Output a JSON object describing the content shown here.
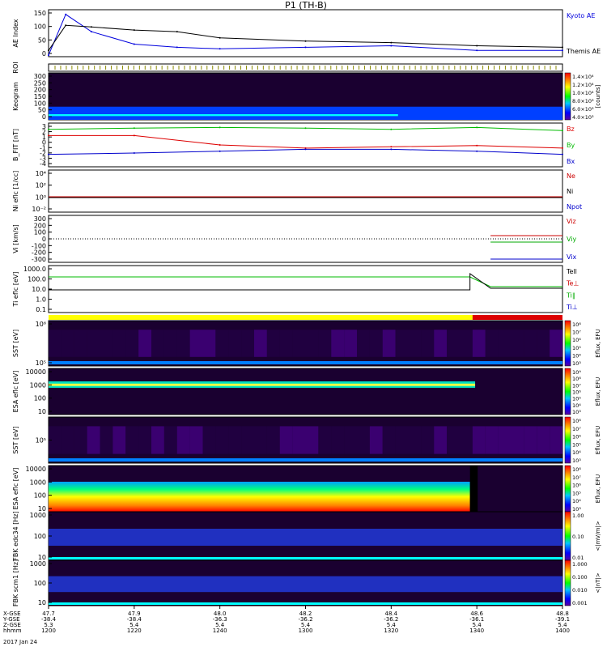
{
  "title": "P1 (TH-B)",
  "colors": {
    "kyoto": "#0000dd",
    "themis": "#000000",
    "bz": "#dd0000",
    "by": "#00bb00",
    "bx": "#0000cc",
    "flag_yellow": "#ffff00",
    "flag_red": "#dd0000"
  },
  "panels": [
    {
      "id": "ae",
      "ylabel": "AE Index",
      "ticks": [
        "150",
        "100",
        "50",
        "0"
      ],
      "legend": [
        "Kyoto AE",
        "Themis AE"
      ]
    },
    {
      "id": "roi",
      "ylabel": "ROI",
      "ticks": [],
      "legend": []
    },
    {
      "id": "keogram",
      "ylabel": "Keogram",
      "ticks": [
        "300",
        "250",
        "200",
        "150",
        "100",
        "50",
        "0"
      ],
      "legend": []
    },
    {
      "id": "bfield",
      "ylabel": "B_FIT [nT]",
      "ticks": [
        "3",
        "2",
        "1",
        "0",
        "-1",
        "-2",
        "-3",
        "-4"
      ],
      "legend": [
        "Bz",
        "By",
        "Bx"
      ]
    },
    {
      "id": "density",
      "ylabel": "Ni eflc [1/cc]",
      "ticks": [
        "10⁴",
        "10²",
        "10⁰",
        "10⁻²"
      ],
      "legend": [
        "Ne",
        "Ni",
        "Npot"
      ]
    },
    {
      "id": "velocity",
      "ylabel": "Vi [km/s]",
      "ticks": [
        "300",
        "200",
        "100",
        "0",
        "-100",
        "-200",
        "-300"
      ],
      "legend": [
        "Viz",
        "Viy",
        "Vix"
      ]
    },
    {
      "id": "temp",
      "ylabel": "Ti eflc [eV]",
      "ticks": [
        "1000.0",
        "100.0",
        "10.0",
        "1.0",
        "0.1"
      ],
      "legend": [
        "Tell",
        "Te⊥",
        "Ti∥",
        "Ti⊥"
      ]
    },
    {
      "id": "sst_e",
      "ylabel": "SST [eV]",
      "ticks": [
        "10⁶",
        "10⁵"
      ],
      "legend": []
    },
    {
      "id": "esa_e",
      "ylabel": "ESA eflc [eV]",
      "ticks": [
        "10000",
        "1000",
        "100",
        "10"
      ],
      "legend": []
    },
    {
      "id": "sst_i",
      "ylabel": "SST [eV]",
      "ticks": [
        "10⁵"
      ],
      "legend": []
    },
    {
      "id": "esa_i",
      "ylabel": "ESA eflc [eV]",
      "ticks": [
        "10000",
        "1000",
        "100",
        "10"
      ],
      "legend": []
    },
    {
      "id": "fbk_scm",
      "ylabel": "FBK edc34 [Hz]",
      "ticks": [
        "1000",
        "100",
        "10"
      ],
      "legend": []
    },
    {
      "id": "fbk_eff",
      "ylabel": "FBK scm1 [Hz]",
      "ticks": [
        "1000",
        "100",
        "10"
      ],
      "legend": []
    }
  ],
  "colorbars": [
    {
      "id": "cb-keogram",
      "label": "[counts]",
      "ticks": [
        "1.4×10⁴",
        "1.2×10⁴",
        "1.0×10⁴",
        "8.0×10³",
        "6.0×10³",
        "4.0×10³"
      ]
    },
    {
      "id": "cb-sst-e",
      "label": "Eflux, EFU",
      "ticks": [
        "10⁸",
        "10⁷",
        "10⁶",
        "10⁵",
        "10⁴",
        "10³"
      ]
    },
    {
      "id": "cb-esa-e",
      "label": "Eflux, EFU",
      "ticks": [
        "10⁹",
        "10⁸",
        "10⁷",
        "10⁶",
        "10⁵",
        "10⁴",
        "10³"
      ]
    },
    {
      "id": "cb-sst-i",
      "label": "Eflux, EFU",
      "ticks": [
        "10⁸",
        "10⁷",
        "10⁶",
        "10⁵",
        "10⁴",
        "10³"
      ]
    },
    {
      "id": "cb-esa-i",
      "label": "Eflux, EFU",
      "ticks": [
        "10⁸",
        "10⁷",
        "10⁶",
        "10⁵",
        "10⁴",
        "10³"
      ]
    },
    {
      "id": "cb-fbk",
      "label": "<|mV/m|>",
      "ticks": [
        "1.00",
        "0.10",
        "0.01"
      ]
    },
    {
      "id": "cb-fbk2",
      "label": "<|nT|>",
      "ticks": [
        "1.000",
        "0.100",
        "0.010",
        "0.001"
      ]
    }
  ],
  "xaxis": {
    "row_labels": [
      "X-GSE",
      "Y-GSE",
      "Z-GSE",
      "hhmm"
    ],
    "date": "2017 Jan 24",
    "columns": [
      {
        "x": "47.7",
        "y": "-38.4",
        "z": "5.3",
        "t": "1200"
      },
      {
        "x": "47.9",
        "y": "-38.4",
        "z": "5.4",
        "t": "1220"
      },
      {
        "x": "48.0",
        "y": "-36.3",
        "z": "5.4",
        "t": "1240"
      },
      {
        "x": "48.2",
        "y": "-36.2",
        "z": "5.4",
        "t": "1300"
      },
      {
        "x": "48.4",
        "y": "-36.2",
        "z": "5.4",
        "t": "1320"
      },
      {
        "x": "48.6",
        "y": "-36.1",
        "z": "5.4",
        "t": "1340"
      },
      {
        "x": "48.8",
        "y": "-39.1",
        "z": "5.4",
        "t": "1400"
      }
    ]
  },
  "chart_data": {
    "type": "line",
    "title": "P1 (TH-B)",
    "x_unit": "hhmm",
    "x_range": [
      "1200",
      "1400"
    ],
    "series": [
      {
        "name": "Kyoto AE",
        "x": [
          "1200",
          "1204",
          "1210",
          "1220",
          "1230",
          "1240",
          "1300",
          "1320",
          "1340",
          "1400"
        ],
        "values": [
          5,
          135,
          80,
          40,
          30,
          25,
          30,
          35,
          20,
          20
        ]
      },
      {
        "name": "Themis AE",
        "x": [
          "1200",
          "1204",
          "1210",
          "1220",
          "1230",
          "1240",
          "1300",
          "1320",
          "1340",
          "1400"
        ],
        "values": [
          20,
          100,
          95,
          85,
          80,
          60,
          50,
          45,
          35,
          30
        ]
      },
      {
        "name": "Bz",
        "x": [
          "1200",
          "1220",
          "1240",
          "1300",
          "1320",
          "1340",
          "1400"
        ],
        "values": [
          1.0,
          1.0,
          -0.5,
          -1.0,
          -0.8,
          -0.6,
          -1.0
        ]
      },
      {
        "name": "By",
        "x": [
          "1200",
          "1220",
          "1240",
          "1300",
          "1320",
          "1340",
          "1400"
        ],
        "values": [
          2.0,
          2.2,
          2.3,
          2.2,
          2.0,
          2.3,
          1.8
        ]
      },
      {
        "name": "Bx",
        "x": [
          "1200",
          "1220",
          "1240",
          "1300",
          "1320",
          "1340",
          "1400"
        ],
        "values": [
          -2.0,
          -1.8,
          -1.5,
          -1.2,
          -1.2,
          -1.5,
          -2.0
        ]
      }
    ],
    "ylim_ae": [
      0,
      150
    ],
    "ylim_b": [
      -4,
      3
    ]
  }
}
